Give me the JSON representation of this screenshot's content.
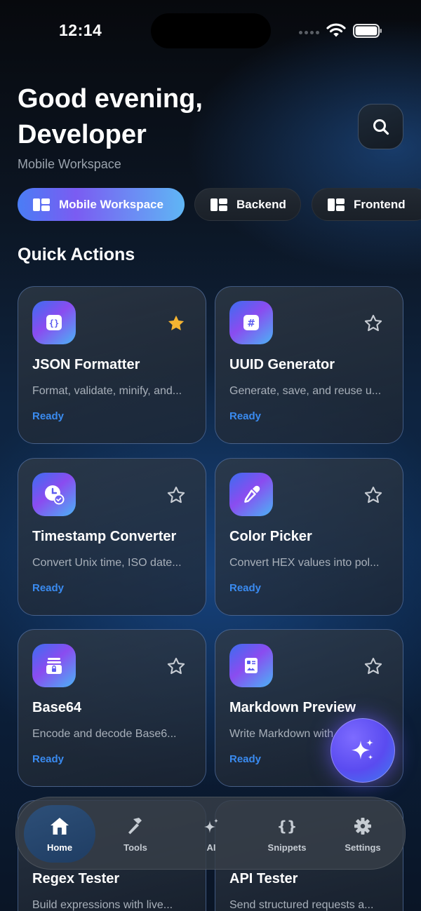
{
  "status_bar": {
    "time": "12:14"
  },
  "header": {
    "greeting_line1": "Good evening,",
    "greeting_line2": "Developer",
    "workspace": "Mobile Workspace"
  },
  "workspaces": [
    {
      "label": "Mobile Workspace",
      "active": true
    },
    {
      "label": "Backend",
      "active": false
    },
    {
      "label": "Frontend",
      "active": false
    }
  ],
  "quick_actions": {
    "title": "Quick Actions",
    "cards": [
      {
        "title": "JSON Formatter",
        "desc": "Format, validate, minify, and...",
        "status": "Ready",
        "icon": "braces-icon",
        "favorite": true
      },
      {
        "title": "UUID Generator",
        "desc": "Generate, save, and reuse u...",
        "status": "Ready",
        "icon": "hash-icon",
        "favorite": false
      },
      {
        "title": "Timestamp Converter",
        "desc": "Convert Unix time, ISO date...",
        "status": "Ready",
        "icon": "clock-check-icon",
        "favorite": false
      },
      {
        "title": "Color Picker",
        "desc": "Convert HEX values into pol...",
        "status": "Ready",
        "icon": "eyedropper-icon",
        "favorite": false
      },
      {
        "title": "Base64",
        "desc": "Encode and decode Base6...",
        "status": "Ready",
        "icon": "archive-lock-icon",
        "favorite": false
      },
      {
        "title": "Markdown Preview",
        "desc": "Write Markdown with...",
        "status": "Ready",
        "icon": "document-icon",
        "favorite": false
      },
      {
        "title": "Regex Tester",
        "desc": "Build expressions with live...",
        "status": "",
        "icon": "",
        "favorite": false
      },
      {
        "title": "API Tester",
        "desc": "Send structured requests a...",
        "status": "",
        "icon": "",
        "favorite": false
      }
    ]
  },
  "nav": [
    {
      "label": "Home",
      "icon": "home-icon",
      "active": true
    },
    {
      "label": "Tools",
      "icon": "hammer-icon",
      "active": false
    },
    {
      "label": "AI",
      "icon": "sparkles-icon",
      "active": false
    },
    {
      "label": "Snippets",
      "icon": "braces-icon",
      "active": false
    },
    {
      "label": "Settings",
      "icon": "gear-icon",
      "active": false
    }
  ],
  "colors": {
    "accent": "#3a8bf0",
    "favorite": "#f5b431",
    "fab": "#6a56f5"
  }
}
